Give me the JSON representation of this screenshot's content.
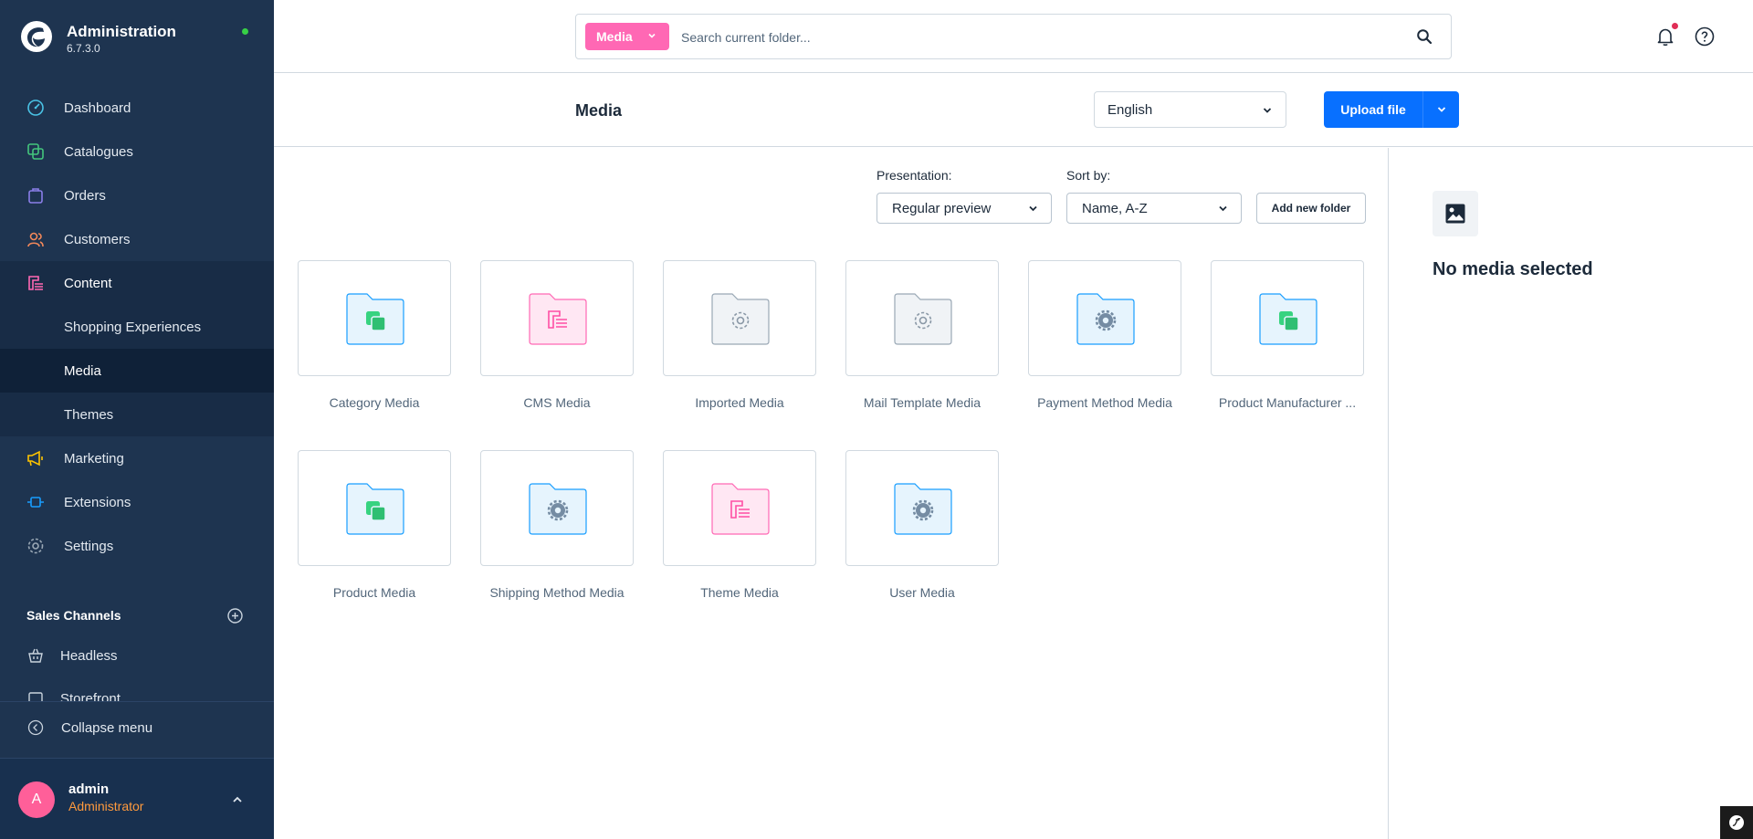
{
  "app": {
    "title": "Administration",
    "version": "6.7.3.0"
  },
  "sidebar": {
    "items": [
      {
        "label": "Dashboard",
        "icon": "dashboard-icon"
      },
      {
        "label": "Catalogues",
        "icon": "catalogues-icon"
      },
      {
        "label": "Orders",
        "icon": "orders-icon"
      },
      {
        "label": "Customers",
        "icon": "customers-icon"
      },
      {
        "label": "Content",
        "icon": "content-icon"
      },
      {
        "label": "Shopping Experiences"
      },
      {
        "label": "Media"
      },
      {
        "label": "Themes"
      },
      {
        "label": "Marketing",
        "icon": "marketing-icon"
      },
      {
        "label": "Extensions",
        "icon": "extensions-icon"
      },
      {
        "label": "Settings",
        "icon": "settings-icon"
      }
    ],
    "sales_channels_title": "Sales Channels",
    "sales_channels": [
      {
        "label": "Headless",
        "icon": "basket-icon"
      },
      {
        "label": "Storefront",
        "icon": "storefront-icon"
      }
    ],
    "collapse_label": "Collapse menu",
    "user": {
      "initial": "A",
      "name": "admin",
      "role": "Administrator"
    }
  },
  "topbar": {
    "search_type": "Media",
    "search_placeholder": "Search current folder..."
  },
  "header": {
    "title": "Media",
    "language": "English",
    "upload_label": "Upload file"
  },
  "toolbar": {
    "presentation_label": "Presentation:",
    "presentation_value": "Regular preview",
    "sort_label": "Sort by:",
    "sort_value": "Name, A-Z",
    "add_folder_label": "Add new folder"
  },
  "folders": [
    {
      "name": "Category Media",
      "icon": "folder-blue-catalogue-icon"
    },
    {
      "name": "CMS Media",
      "icon": "folder-pink-content-icon"
    },
    {
      "name": "Imported Media",
      "icon": "folder-grey-gear-icon"
    },
    {
      "name": "Mail Template Media",
      "icon": "folder-grey-gear-icon"
    },
    {
      "name": "Payment Method Media",
      "icon": "folder-blue-gear-icon"
    },
    {
      "name": "Product Manufacturer ...",
      "icon": "folder-blue-catalogue-icon"
    },
    {
      "name": "Product Media",
      "icon": "folder-blue-catalogue-icon"
    },
    {
      "name": "Shipping Method Media",
      "icon": "folder-blue-gear-icon"
    },
    {
      "name": "Theme Media",
      "icon": "folder-pink-content-icon"
    },
    {
      "name": "User Media",
      "icon": "folder-blue-gear-icon"
    }
  ],
  "preview": {
    "empty_label": "No media selected"
  },
  "colors": {
    "sidebar_bg": "#1e3450",
    "accent_blue": "#0870ff",
    "accent_pink": "#ff68b4",
    "user_role": "#ff9a3d"
  }
}
